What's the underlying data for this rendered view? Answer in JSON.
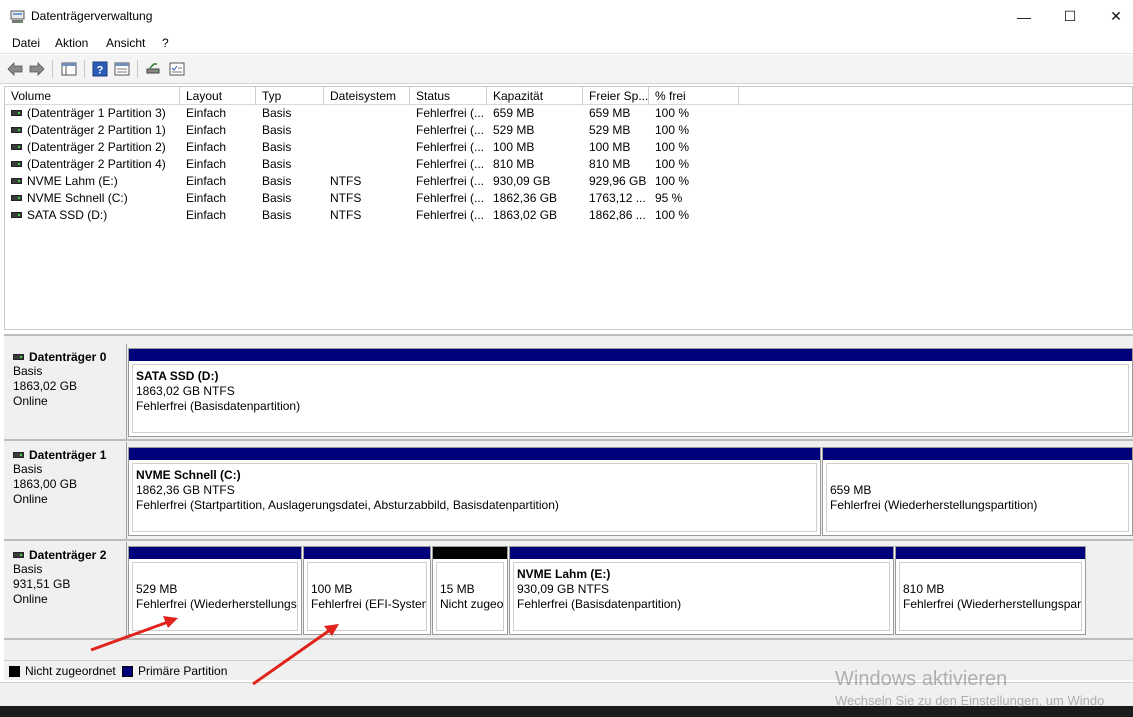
{
  "window": {
    "title": "Datenträgerverwaltung",
    "controls": {
      "minimize": "—",
      "maximize": "☐",
      "close": "✕"
    }
  },
  "menu": [
    "Datei",
    "Aktion",
    "Ansicht",
    "?"
  ],
  "toolbar": {
    "icons": [
      "back-arrow-icon",
      "forward-arrow-icon",
      "show-hide-console-icon",
      "help-icon",
      "properties-icon",
      "connect-drive-icon",
      "checklist-icon"
    ]
  },
  "volume_list": {
    "columns": [
      "Volume",
      "Layout",
      "Typ",
      "Dateisystem",
      "Status",
      "Kapazität",
      "Freier Sp...",
      "% frei"
    ],
    "rows": [
      [
        "(Datenträger 1 Partition 3)",
        "Einfach",
        "Basis",
        "",
        "Fehlerfrei (...",
        "659 MB",
        "659 MB",
        "100 %"
      ],
      [
        "(Datenträger 2 Partition 1)",
        "Einfach",
        "Basis",
        "",
        "Fehlerfrei (...",
        "529 MB",
        "529 MB",
        "100 %"
      ],
      [
        "(Datenträger 2 Partition 2)",
        "Einfach",
        "Basis",
        "",
        "Fehlerfrei (...",
        "100 MB",
        "100 MB",
        "100 %"
      ],
      [
        "(Datenträger 2 Partition 4)",
        "Einfach",
        "Basis",
        "",
        "Fehlerfrei (...",
        "810 MB",
        "810 MB",
        "100 %"
      ],
      [
        "NVME Lahm (E:)",
        "Einfach",
        "Basis",
        "NTFS",
        "Fehlerfrei (...",
        "930,09 GB",
        "929,96 GB",
        "100 %"
      ],
      [
        "NVME Schnell (C:)",
        "Einfach",
        "Basis",
        "NTFS",
        "Fehlerfrei (...",
        "1862,36 GB",
        "1763,12 ...",
        "95 %"
      ],
      [
        "SATA SSD (D:)",
        "Einfach",
        "Basis",
        "NTFS",
        "Fehlerfrei (...",
        "1863,02 GB",
        "1862,86 ...",
        "100 %"
      ]
    ]
  },
  "disks": [
    {
      "name": "Datenträger 0",
      "type": "Basis",
      "size": "1863,02 GB",
      "state": "Online",
      "partitions": [
        {
          "name": "SATA SSD  (D:)",
          "size": "1863,02 GB NTFS",
          "status": "Fehlerfrei (Basisdatenpartition)",
          "kind": "primary"
        }
      ]
    },
    {
      "name": "Datenträger 1",
      "type": "Basis",
      "size": "1863,00 GB",
      "state": "Online",
      "partitions": [
        {
          "name": "NVME Schnell  (C:)",
          "size": "1862,36 GB NTFS",
          "status": "Fehlerfrei (Startpartition, Auslagerungsdatei, Absturzabbild, Basisdatenpartition)",
          "kind": "primary"
        },
        {
          "name": "",
          "size": "659 MB",
          "status": "Fehlerfrei (Wiederherstellungspartition)",
          "kind": "primary"
        }
      ]
    },
    {
      "name": "Datenträger 2",
      "type": "Basis",
      "size": "931,51 GB",
      "state": "Online",
      "partitions": [
        {
          "name": "",
          "size": "529 MB",
          "status": "Fehlerfrei (Wiederherstellungsp",
          "kind": "primary"
        },
        {
          "name": "",
          "size": "100 MB",
          "status": "Fehlerfrei (EFI-System",
          "kind": "primary"
        },
        {
          "name": "",
          "size": "15 MB",
          "status": "Nicht zugeo",
          "kind": "unallocated"
        },
        {
          "name": "NVME Lahm  (E:)",
          "size": "930,09 GB NTFS",
          "status": "Fehlerfrei (Basisdatenpartition)",
          "kind": "primary"
        },
        {
          "name": "",
          "size": "810 MB",
          "status": "Fehlerfrei (Wiederherstellungspar",
          "kind": "primary"
        }
      ]
    }
  ],
  "legend": {
    "unallocated": "Nicht zugeordnet",
    "primary": "Primäre Partition"
  },
  "watermark": {
    "line1": "Windows aktivieren",
    "line2": "Wechseln Sie zu den Einstellungen, um Windo"
  },
  "colors": {
    "primary_partition": "#00007a",
    "unallocated": "#000000",
    "annotation_arrow": "#e0231c"
  }
}
